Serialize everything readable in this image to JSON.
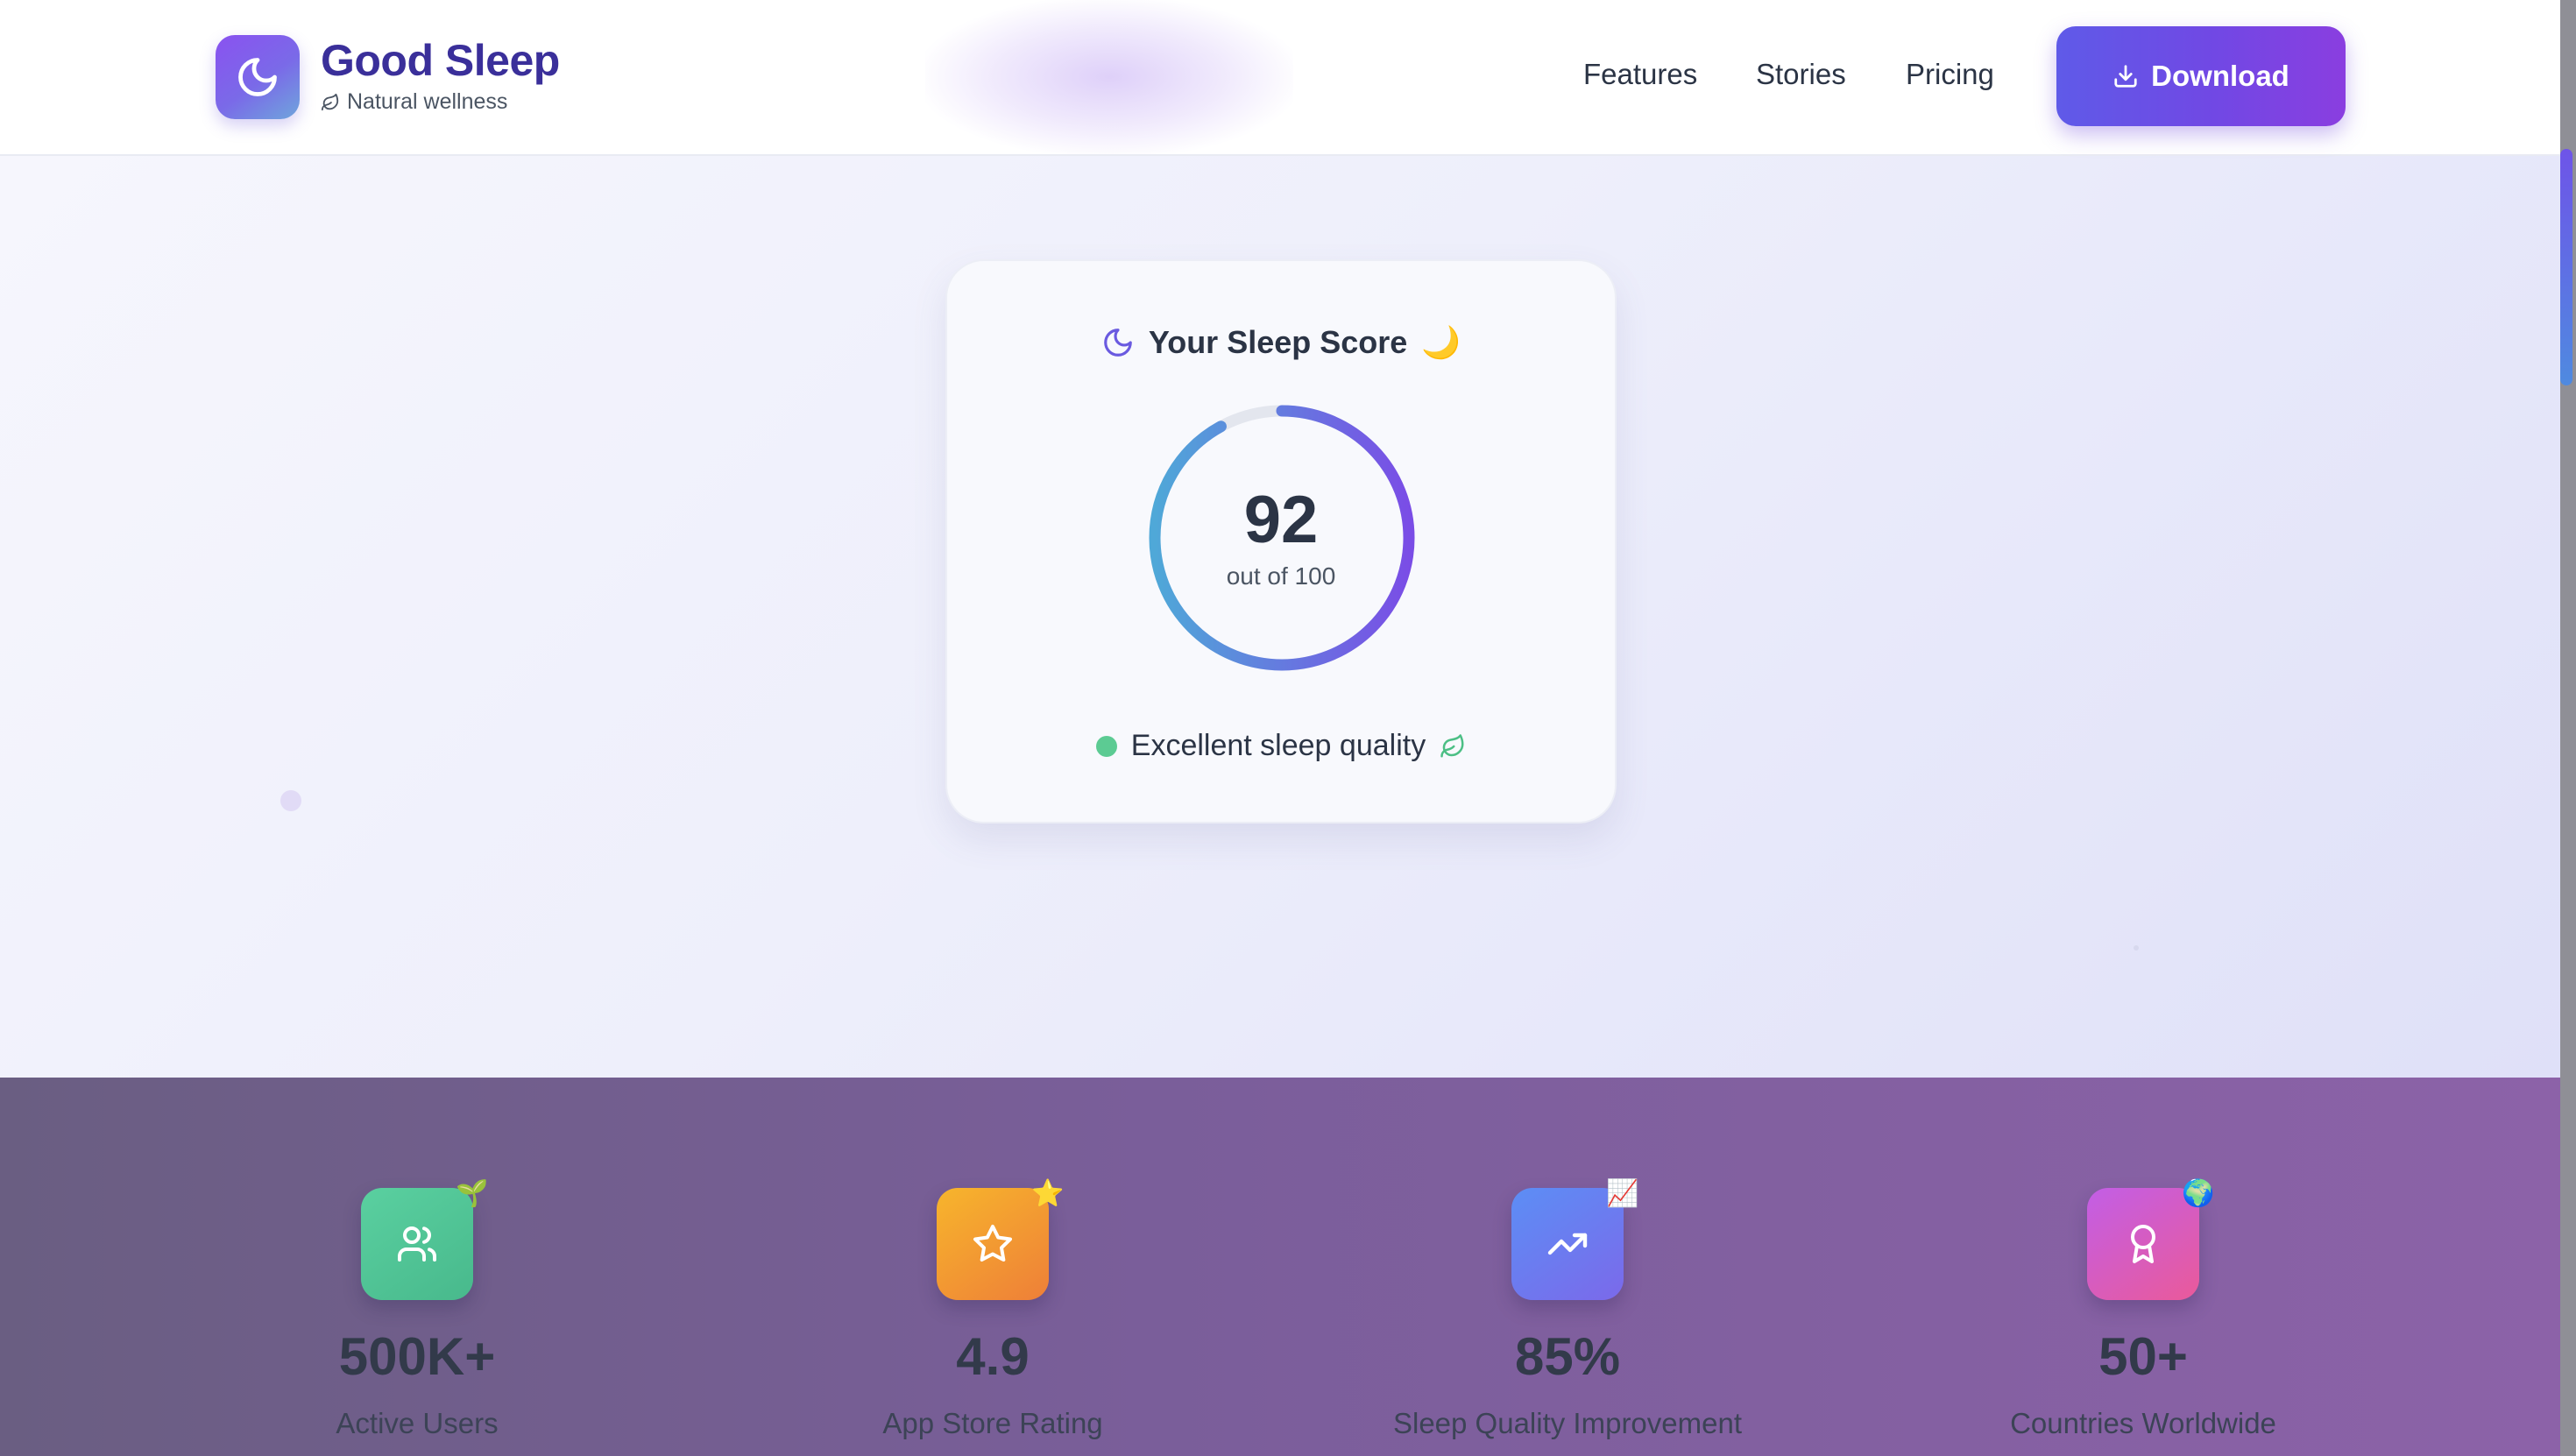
{
  "header": {
    "brand": {
      "title": "Good Sleep",
      "subtitle": "Natural wellness",
      "logo_icon": "moon-icon",
      "subtitle_icon": "leaf-icon"
    },
    "nav": {
      "features": "Features",
      "stories": "Stories",
      "pricing": "Pricing"
    },
    "download_label": "Download",
    "download_icon": "download-icon"
  },
  "score_card": {
    "title": "Your Sleep Score",
    "title_emoji": "🌙",
    "score": "92",
    "score_fraction": 0.92,
    "score_max_label": "out of 100",
    "quality_label": "Excellent sleep quality",
    "colors": {
      "ring_start": "#4fa8d8",
      "ring_end": "#7a4de6",
      "status": "#5ccb93"
    }
  },
  "stats": [
    {
      "value": "500K+",
      "label": "Active Users",
      "icon": "users-icon",
      "badge": "🌱"
    },
    {
      "value": "4.9",
      "label": "App Store Rating",
      "icon": "star-icon",
      "badge": "⭐"
    },
    {
      "value": "85%",
      "label": "Sleep Quality Improvement",
      "icon": "trending-up-icon",
      "badge": "📈"
    },
    {
      "value": "50+",
      "label": "Countries Worldwide",
      "icon": "award-icon",
      "badge": "🌍"
    }
  ],
  "colors": {
    "brand": "#3a2f9a",
    "accent": "#6f4ee6"
  }
}
